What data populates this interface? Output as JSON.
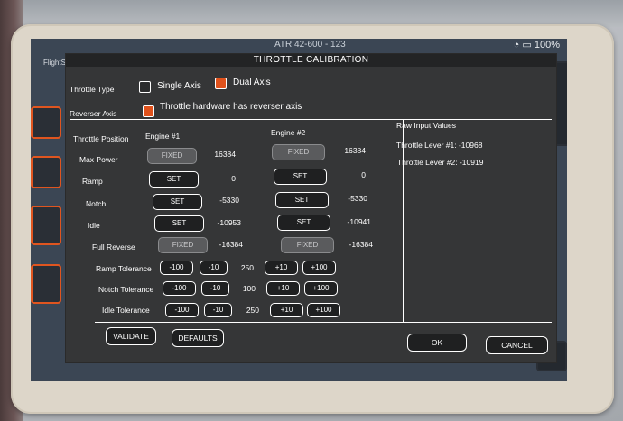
{
  "status_bar": {
    "time": "ATR 42-600 - 123",
    "battery": "100%"
  },
  "window_label": "FlightSimulator.com",
  "dialog": {
    "title": "THROTTLE CALIBRATION",
    "throttle_type": {
      "label": "Throttle Type",
      "single_axis": "Single Axis",
      "dual_axis": "Dual Axis",
      "selected": "Dual Axis"
    },
    "reverser_axis": {
      "label": "Reverser Axis",
      "checkbox_label": "Throttle hardware has reverser axis",
      "checked": true
    },
    "columns": {
      "throttle_position": "Throttle Position",
      "engine1": "Engine #1",
      "engine2": "Engine #2"
    },
    "rows": {
      "max_power": {
        "label": "Max Power",
        "e1_button": "FIXED",
        "e1_value": "16384",
        "e2_button": "FIXED",
        "e2_value": "16384"
      },
      "ramp": {
        "label": "Ramp",
        "e1_button": "SET",
        "e1_value": "0",
        "e2_button": "SET",
        "e2_value": "0"
      },
      "notch": {
        "label": "Notch",
        "e1_button": "SET",
        "e1_value": "-5330",
        "e2_button": "SET",
        "e2_value": "-5330"
      },
      "idle": {
        "label": "Idle",
        "e1_button": "SET",
        "e1_value": "-10953",
        "e2_button": "SET",
        "e2_value": "-10941"
      },
      "full_reverse": {
        "label": "Full Reverse",
        "e1_button": "FIXED",
        "e1_value": "-16384",
        "e2_button": "FIXED",
        "e2_value": "-16384"
      }
    },
    "tolerances": {
      "ramp": {
        "label": "Ramp Tolerance",
        "m100": "-100",
        "m10": "-10",
        "value": "250",
        "p10": "+10",
        "p100": "+100"
      },
      "notch": {
        "label": "Notch Tolerance",
        "m100": "-100",
        "m10": "-10",
        "value": "100",
        "p10": "+10",
        "p100": "+100"
      },
      "idle": {
        "label": "Idle Tolerance",
        "m100": "-100",
        "m10": "-10",
        "value": "250",
        "p10": "+10",
        "p100": "+100"
      }
    },
    "raw_input": {
      "title": "Raw Input Values",
      "lever1": "Throttle Lever #1: -10968",
      "lever2": "Throttle Lever #2: -10919"
    },
    "buttons": {
      "validate": "VALIDATE",
      "defaults": "DEFAULTS",
      "ok": "OK",
      "cancel": "CANCEL"
    }
  },
  "colors": {
    "accent_orange": "#e0521c",
    "dialog_bg": "#353637",
    "titlebar_bg": "#232425",
    "bezel": "#ddd6c9"
  }
}
